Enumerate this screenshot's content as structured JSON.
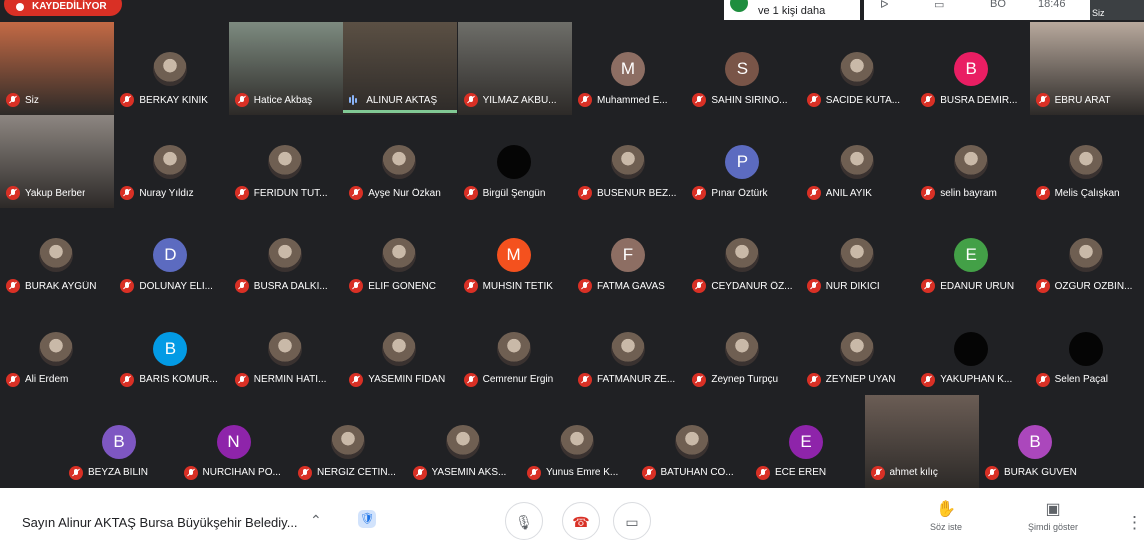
{
  "top": {
    "recording": "KAYDEDİLİYOR",
    "notification": "ve 1 kişi daha",
    "tools": [
      "ᐅ",
      "▭",
      "BO",
      "18:46"
    ],
    "self_label": "Siz"
  },
  "participants": [
    {
      "name": "Siz",
      "kind": "video",
      "color": "#c46a45"
    },
    {
      "name": "BERKAY KINIK",
      "kind": "photo"
    },
    {
      "name": "Hatice Akbaş",
      "kind": "video",
      "color": "#7d8b80"
    },
    {
      "name": "ALİNUR AKTAŞ",
      "kind": "video",
      "color": "#5b5044",
      "speaking": true
    },
    {
      "name": "YILMAZ AKBU...",
      "kind": "video",
      "color": "#6e6e69"
    },
    {
      "name": "Muhammed E...",
      "kind": "letter",
      "letter": "M",
      "color": "#8d6e63"
    },
    {
      "name": "SAHIN SIRINO...",
      "kind": "letter",
      "letter": "S",
      "color": "#795548"
    },
    {
      "name": "SACIDE KUTA...",
      "kind": "photo"
    },
    {
      "name": "BUSRA DEMIR...",
      "kind": "letter",
      "letter": "B",
      "color": "#e91e63"
    },
    {
      "name": "EBRU ARAT",
      "kind": "video",
      "color": "#b8a99d"
    },
    {
      "name": "Yakup Berber",
      "kind": "video",
      "color": "#8d8681"
    },
    {
      "name": "Nuray Yıldız",
      "kind": "photo"
    },
    {
      "name": "FERIDUN TUT...",
      "kind": "photo"
    },
    {
      "name": "Ayşe Nur Özkan",
      "kind": "photo"
    },
    {
      "name": "Birgül Şengün",
      "kind": "dark"
    },
    {
      "name": "BUSENUR BEZ...",
      "kind": "photo"
    },
    {
      "name": "Pınar Öztürk",
      "kind": "letter",
      "letter": "P",
      "color": "#5c6bc0"
    },
    {
      "name": "ANIL AYIK",
      "kind": "photo"
    },
    {
      "name": "selin bayram",
      "kind": "photo"
    },
    {
      "name": "Melis Çalışkan",
      "kind": "photo"
    },
    {
      "name": "BURAK AYGÜN",
      "kind": "photo"
    },
    {
      "name": "DOLUNAY ELİ...",
      "kind": "letter",
      "letter": "D",
      "color": "#5c6bc0"
    },
    {
      "name": "BUSRA DALKI...",
      "kind": "photo"
    },
    {
      "name": "ELIF GONENC",
      "kind": "photo"
    },
    {
      "name": "MUHSIN TETIK",
      "kind": "letter",
      "letter": "M",
      "color": "#f4511e"
    },
    {
      "name": "FATMA GAVAS",
      "kind": "letter",
      "letter": "F",
      "color": "#8d6e63"
    },
    {
      "name": "CEYDANUR ÖZ...",
      "kind": "photo"
    },
    {
      "name": "NUR DIKICI",
      "kind": "photo"
    },
    {
      "name": "EDANUR URUN",
      "kind": "letter",
      "letter": "E",
      "color": "#43a047"
    },
    {
      "name": "OZGUR OZBIN...",
      "kind": "photo"
    },
    {
      "name": "Ali Erdem",
      "kind": "photo"
    },
    {
      "name": "BARIS KOMUR...",
      "kind": "letter",
      "letter": "B",
      "color": "#039be5"
    },
    {
      "name": "NERMIN HATI...",
      "kind": "photo"
    },
    {
      "name": "YASEMIN FIDAN",
      "kind": "photo"
    },
    {
      "name": "Cemrenur Ergin",
      "kind": "photo"
    },
    {
      "name": "FATMANUR ZE...",
      "kind": "photo"
    },
    {
      "name": "Zeynep Turpçu",
      "kind": "photo"
    },
    {
      "name": "ZEYNEP UYAN",
      "kind": "photo"
    },
    {
      "name": "YAKUPHAN K...",
      "kind": "dark"
    },
    {
      "name": "Selen Paçal",
      "kind": "dark"
    },
    {
      "name": "BEYZA BILIN",
      "kind": "letter",
      "letter": "B",
      "color": "#7e57c2"
    },
    {
      "name": "NURCIHAN PO...",
      "kind": "letter",
      "letter": "N",
      "color": "#8e24aa"
    },
    {
      "name": "NERGIZ CETIN...",
      "kind": "photo"
    },
    {
      "name": "YASEMIN AKS...",
      "kind": "photo"
    },
    {
      "name": "Yunus Emre K...",
      "kind": "photo"
    },
    {
      "name": "BATUHAN CO...",
      "kind": "photo"
    },
    {
      "name": "ECE EREN",
      "kind": "letter",
      "letter": "E",
      "color": "#8e24aa"
    },
    {
      "name": "ahmet kılıç",
      "kind": "video",
      "color": "#6b5d55"
    },
    {
      "name": "BURAK GUVEN",
      "kind": "letter",
      "letter": "B",
      "color": "#ab47bc"
    }
  ],
  "bottom": {
    "meeting_title": "Sayın Alinur AKTAŞ Bursa Büyükşehir Belediy...",
    "chevron": "⌃",
    "mic": "🎙",
    "hangup": "☎",
    "camera": "▭",
    "raise_hand": "Söz iste",
    "present": "Şimdi göster",
    "more": "⋮",
    "shield": "🛡"
  }
}
